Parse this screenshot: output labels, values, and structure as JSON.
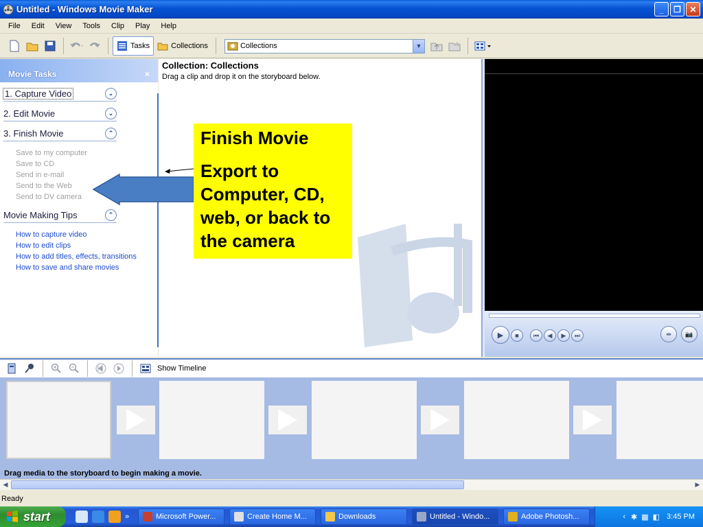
{
  "window": {
    "title": "Untitled - Windows Movie Maker"
  },
  "menu": [
    "File",
    "Edit",
    "View",
    "Tools",
    "Clip",
    "Play",
    "Help"
  ],
  "toolbar": {
    "tasks_label": "Tasks",
    "collections_label": "Collections",
    "combo_value": "Collections"
  },
  "taskpane": {
    "header": "Movie Tasks",
    "close": "×",
    "sections": [
      {
        "label": "1. Capture Video",
        "expanded": false
      },
      {
        "label": "2. Edit Movie",
        "expanded": false
      },
      {
        "label": "3. Finish Movie",
        "expanded": true
      },
      {
        "label": "Movie Making Tips",
        "expanded": true
      }
    ],
    "finish_items": [
      "Save to my computer",
      "Save to CD",
      "Send in e-mail",
      "Send to the Web",
      "Send to DV camera"
    ],
    "tips": [
      "How to capture video",
      "How to edit clips",
      "How to add titles, effects, transitions",
      "How to save and share movies"
    ]
  },
  "collection": {
    "title": "Collection: Collections",
    "hint": "Drag a clip and drop it on the storyboard below."
  },
  "callout": {
    "title": "Finish Movie",
    "body": "Export to Computer, CD, web, or back to the camera"
  },
  "storyboard": {
    "show_timeline": "Show Timeline",
    "hint": "Drag media to the storyboard to begin making a movie."
  },
  "status": "Ready",
  "taskbar": {
    "start": "start",
    "buttons": [
      {
        "label": "Microsoft Power...",
        "color": "#c8402a"
      },
      {
        "label": "Create Home M...",
        "color": "#e0e0e0"
      },
      {
        "label": "Downloads",
        "color": "#f2c84a"
      },
      {
        "label": "Untitled - Windo...",
        "color": "#9aa8c8"
      },
      {
        "label": "Adobe Photosh...",
        "color": "#e0b020"
      }
    ],
    "clock": "3:45 PM"
  },
  "colors": {
    "callout": "#ffff00",
    "arrow": "#4a7ec4",
    "link": "#1c4bd0"
  }
}
